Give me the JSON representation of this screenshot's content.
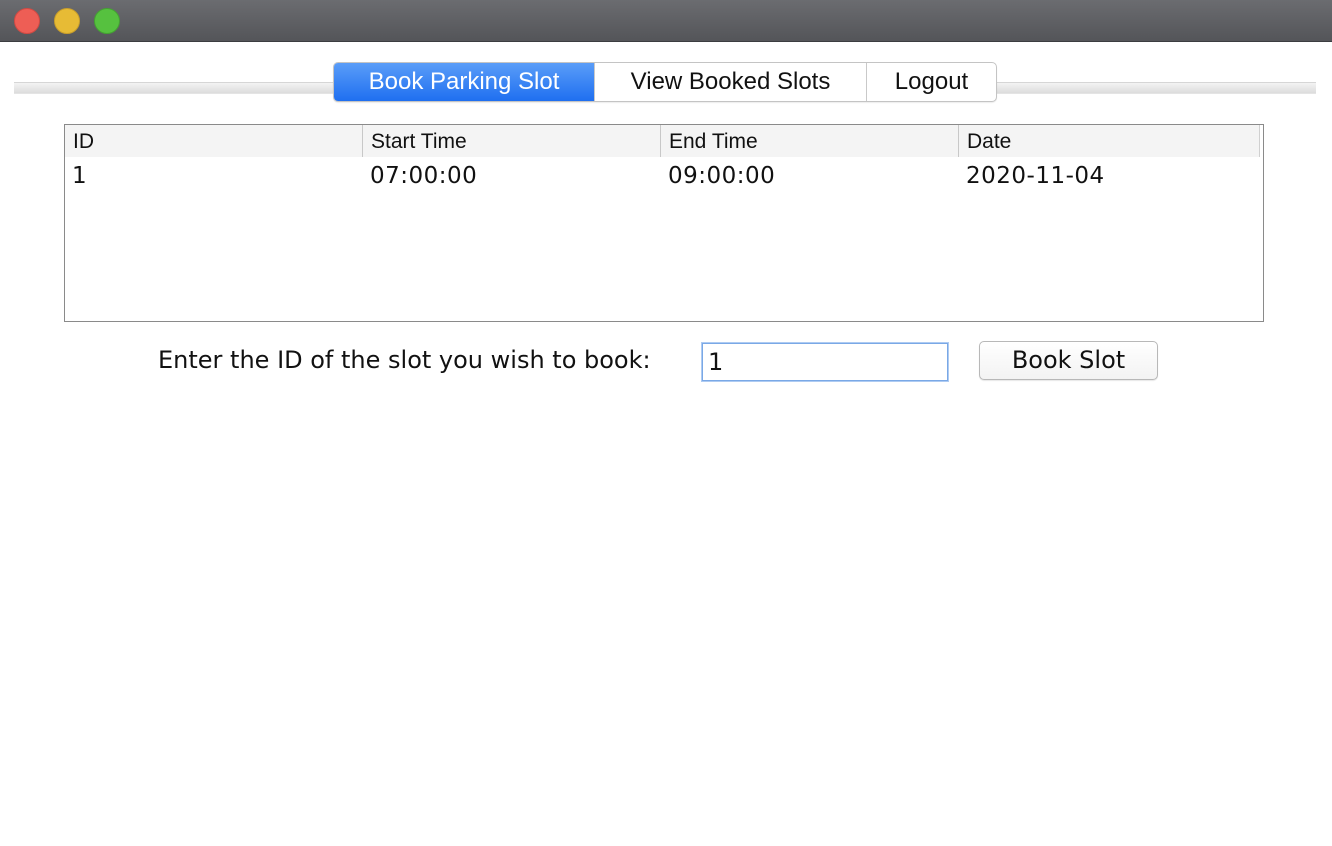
{
  "window": {
    "controls": [
      "close",
      "minimize",
      "zoom"
    ]
  },
  "tabs": [
    {
      "label": "Book Parking Slot",
      "selected": true
    },
    {
      "label": "View Booked Slots",
      "selected": false
    },
    {
      "label": "Logout",
      "selected": false
    }
  ],
  "table": {
    "columns": [
      "ID",
      "Start Time",
      "End Time",
      "Date"
    ],
    "rows": [
      [
        "1",
        "07:00:00",
        "09:00:00",
        "2020-11-04"
      ]
    ]
  },
  "booking": {
    "prompt": "Enter the ID of the slot you wish to book:",
    "input_value": "1",
    "button_label": "Book Slot"
  },
  "colors": {
    "accent": "#2a78f1",
    "close": "#ee5e55",
    "minimize": "#e7bb35",
    "zoom": "#56c13f"
  }
}
